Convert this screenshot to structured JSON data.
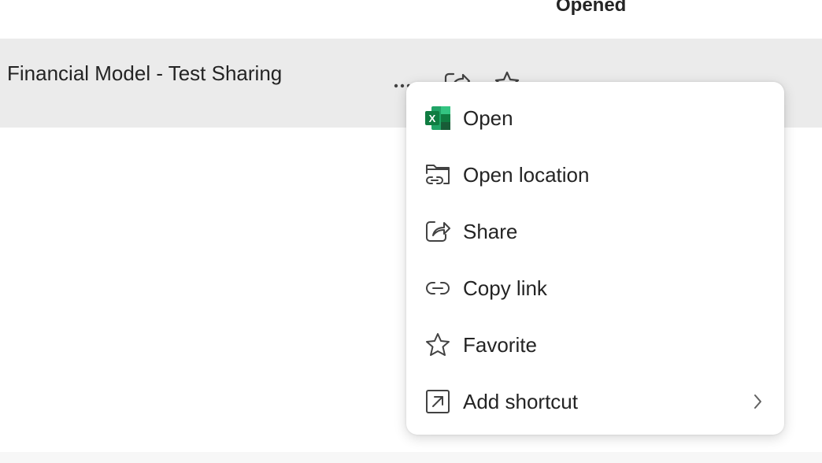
{
  "header": {
    "column_label": "Opened"
  },
  "file_row": {
    "name": "Financial Model - Test Sharing",
    "actions": [
      {
        "icon": "more-icon"
      },
      {
        "icon": "share-icon"
      },
      {
        "icon": "star-icon"
      }
    ]
  },
  "context_menu": {
    "items": [
      {
        "label": "Open",
        "icon": "excel-icon"
      },
      {
        "label": "Open location",
        "icon": "folder-link-icon"
      },
      {
        "label": "Share",
        "icon": "share-icon"
      },
      {
        "label": "Copy link",
        "icon": "link-icon"
      },
      {
        "label": "Favorite",
        "icon": "star-icon"
      },
      {
        "label": "Add shortcut",
        "icon": "shortcut-icon",
        "has_submenu": true
      }
    ]
  },
  "colors": {
    "row_hover": "#ebebeb",
    "text": "#242424",
    "icon_stroke": "#424242",
    "excel_dark": "#107c41",
    "excel_light": "#33c481"
  }
}
